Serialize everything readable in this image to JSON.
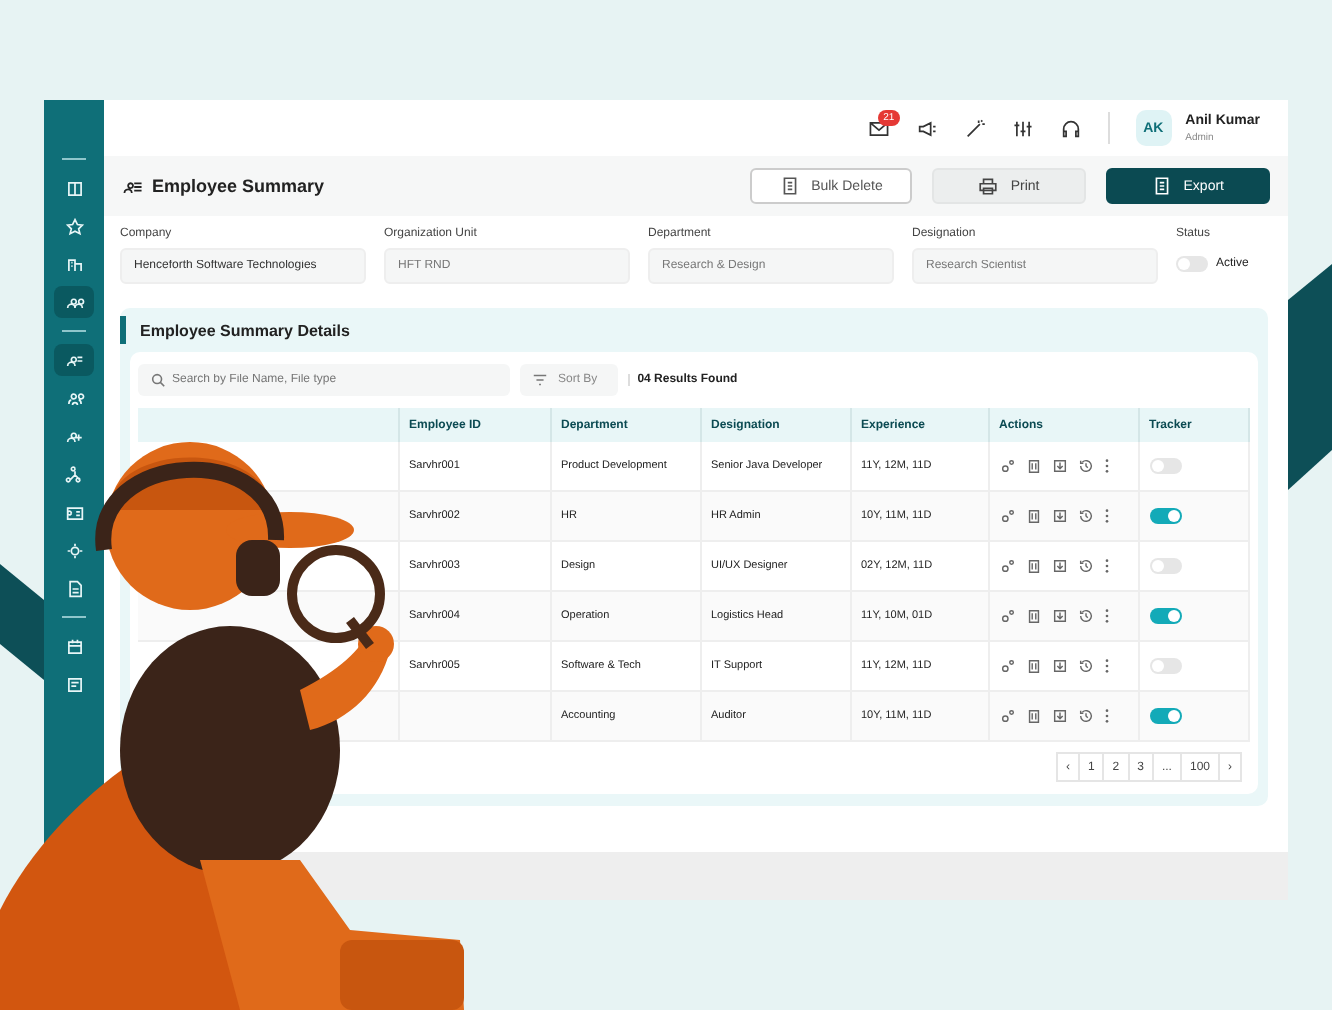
{
  "sidebar": {
    "items": [
      {
        "selected": false
      },
      {
        "selected": false
      },
      {
        "selected": false
      },
      {
        "selected": true
      },
      {
        "selected": true
      },
      {
        "selected": false
      },
      {
        "selected": false
      },
      {
        "selected": false
      },
      {
        "selected": false
      },
      {
        "selected": false
      },
      {
        "selected": false
      },
      {
        "selected": false
      },
      {
        "selected": false
      }
    ]
  },
  "header": {
    "notification_badge": "21",
    "user": {
      "initials": "AK",
      "name": "Anil Kumar",
      "role": "Admin"
    }
  },
  "page": {
    "title": "Employee Summary",
    "buttons": [
      {
        "label": "Bulk Delete",
        "kind": "outline"
      },
      {
        "label": "Print",
        "kind": "secondary"
      },
      {
        "label": "Export",
        "kind": "primary"
      }
    ]
  },
  "filters": [
    {
      "label": "Company",
      "value": "Henceforth Software Technologies"
    },
    {
      "label": "Organization Unit",
      "placeholder": "HFT RND"
    },
    {
      "label": "Department",
      "placeholder": "Research & Design"
    },
    {
      "label": "Designation",
      "placeholder": "Research Scientist"
    }
  ],
  "status": {
    "label": "Status",
    "toggle_label": "Active",
    "on": false
  },
  "details": {
    "title": "Employee Summary Details",
    "search": {
      "placeholder": "Search by File Name, File type"
    },
    "sort": "Sort By",
    "results": "04 Results Found",
    "columns": [
      "Employee ID",
      "Department",
      "Designation",
      "Experience",
      "Actions",
      "Tracker"
    ],
    "rows": [
      {
        "employee_id": "Sarvhr001",
        "department": "Product Development",
        "designation": "Senior Java Developer",
        "experience": "11Y, 12M, 11D",
        "tracker_on": false
      },
      {
        "employee_id": "Sarvhr002",
        "department": "HR",
        "designation": "HR Admin",
        "experience": "10Y, 11M, 11D",
        "tracker_on": true
      },
      {
        "employee_id": "Sarvhr003",
        "department": "Design",
        "designation": "UI/UX Designer",
        "experience": "02Y, 12M, 11D",
        "tracker_on": false
      },
      {
        "employee_id": "Sarvhr004",
        "department": "Operation",
        "designation": "Logistics Head",
        "experience": "11Y, 10M, 01D",
        "tracker_on": true
      },
      {
        "employee_id": "Sarvhr005",
        "department": "Software & Tech",
        "designation": "IT Support",
        "experience": "11Y, 12M, 11D",
        "tracker_on": false
      },
      {
        "department": "Accounting",
        "designation": "Auditor",
        "experience": "10Y, 11M, 11D",
        "tracker_on": true
      }
    ],
    "pagination": {
      "prev": "‹",
      "pages": [
        "1",
        "2",
        "3",
        "...",
        "100"
      ],
      "next": "›"
    }
  }
}
